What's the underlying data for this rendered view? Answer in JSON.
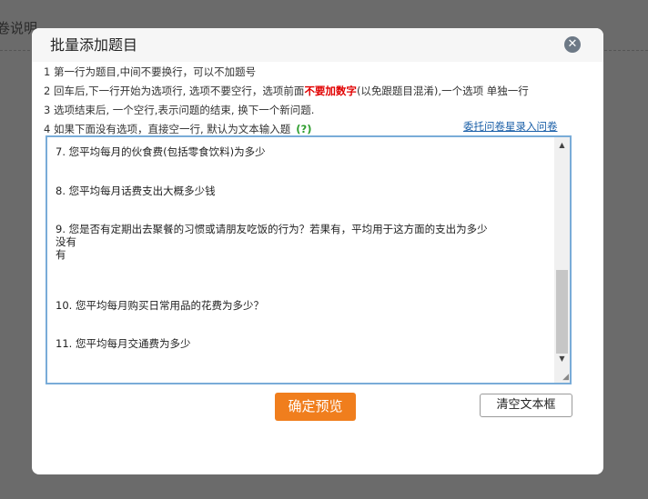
{
  "background": {
    "label": "卷说明"
  },
  "dialog": {
    "title": "批量添加题目",
    "close_icon": "close-icon"
  },
  "instructions": {
    "line1": "1 第一行为题目,中间不要换行，可以不加题号",
    "line2_before": "2 回车后,下一行开始为选项行, 选项不要空行，选项前面",
    "line2_highlight": "不要加数字",
    "line2_after": "(以免跟题目混淆),一个选项 单独一行",
    "line3": "3 选项结束后, 一个空行,表示问题的结束, 换下一个新问题.",
    "line4": "4 如果下面没有选项，直接空一行, 默认为文本输入题",
    "help_label": "(?)"
  },
  "delegate_link": "委托问卷星录入问卷",
  "editor": {
    "lines": [
      "7. 您平均每月的伙食费(包括零食饮料)为多少",
      "8. 您平均每月话费支出大概多少钱",
      "9. 您是否有定期出去聚餐的习惯或请朋友吃饭的行为？若果有，平均用于这方面的支出为多少",
      "没有",
      "有",
      "10. 您平均每月购买日常用品的花费为多少？",
      "11. 您平均每月交通费为多少"
    ]
  },
  "buttons": {
    "confirm": "确定预览",
    "clear": "清空文本框"
  },
  "colors": {
    "accent_orange": "#f07e1d",
    "link_blue": "#1a5fa8",
    "warning_red": "#e10000",
    "help_green": "#2f9e2f"
  }
}
